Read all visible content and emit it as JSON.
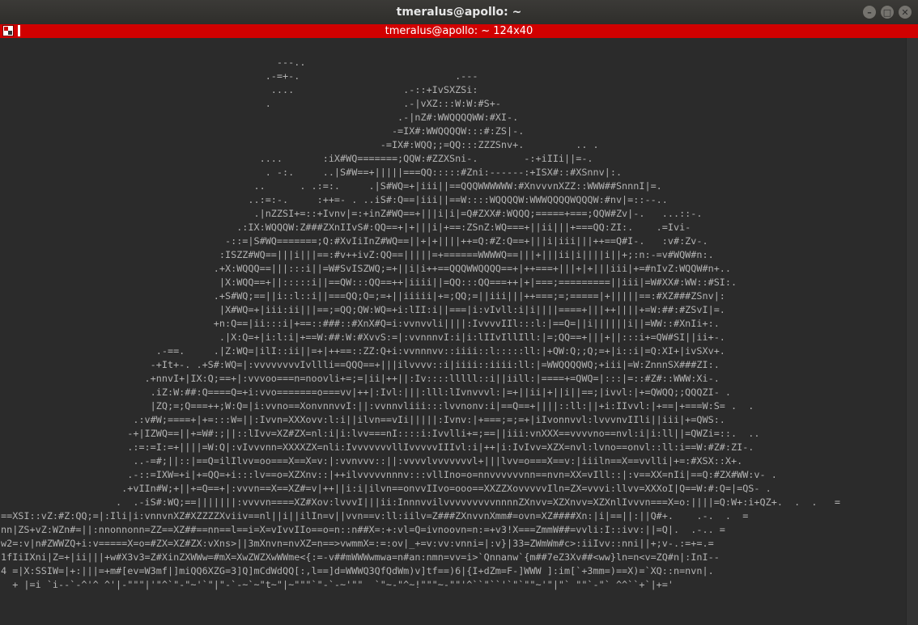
{
  "window": {
    "title": "tmeralus@apollo: ~",
    "controls": {
      "minimize": "–",
      "maximize": "□",
      "close": "✕"
    }
  },
  "tab": {
    "title": "tmeralus@apollo: ~ 124x40"
  },
  "terminal": {
    "lines": [
      "                                                ---..",
      "                                              .-=+-.                           .---",
      "                                               ....                   .-::+IvSXZSi:",
      "                                              .                       .-|vXZ:::W:W:#S+-",
      "                                                                     .-|nZ#:WWQQQQWW:#XI-.",
      "                                                                    -=IX#:WWQQQQW:::#:ZS|-.",
      "                                                                  -=IX#:WQQ;;=QQ:::ZZZSnv+.         .. .",
      "                                             ....       :iX#WQ=======;QQW:#ZZXSni-.        -:+iIIi||=-.",
      "                                              . -:.     ..|S#W==+|||||===QQ:::::#Zni:------:+ISX#::#XSnnv|:.",
      "                                            ..      . .:=:.     .|S#WQ=+|iii||==QQQWWWWWW:#XnvvvnXZZ::WWW##SnnnI|=.",
      "                                           ..:=:-.     :++=- . ..iS#:Q==|iii||==W::::WQQQQW:WWWQQQQWQQQW:#nv|=::--..",
      "                                            .|nZZSI+=::+Ivnv|=:+inZ#WQ==+|||i|i|=Q#ZXX#:WQQQ;=====+===;QQW#Zv|-.   ...::-.",
      "                                         .:IX:WQQQW:Z###ZXnIIvS#:QQ==+|+|||i|+==:ZSnZ:WQ===+||ii|||+===QQ:ZI:.    .=Ivi-",
      "                                       -::=|S#WQ=======;Q:#XvIiInZ#WQ==||+|+||||++=Q:#Z:Q==+|||i|iii|||++==Q#I-.   :v#:Zv-.",
      "                                      :ISZZ#WQ==|||i|||==:#v++ivZ:QQ==|||||=+======WWWWQ==|||+|||ii|i||||i||+;:n:-=v#WQW#n:.",
      "                                     .+X:WQQQ==|||:::i||=W#SvISZWQ;=+||i|i++==QQQWWQQQQ==+|++===+|||+|+|||iii|+=#nIvZ:WQQW#n+..",
      "                                      |X:WQQ==+||:::::i||==QW:::QQ==++|iiii||=QQ:::QQ===++|+|===;=========||iii|=W#XX#:WW::#SI:.",
      "                                     .+S#WQ;==||i::l::i||===QQ;Q=;=+||iiiii|+=;QQ;=||iii|||++===;=;=====|+|||||==:#XZ###ZSnv|:",
      "                                      |X#WQ=+|iii:ii|||==;=QQ;QW:WQ=+i:lII:i||===|i:vIvll:i|i||||====+|||++||||+=W:##:#ZSvI|=.",
      "                                     +n:Q==|ii:::i|+==::###::#XnX#Q=i:vvnvvli||||:IvvvvIIl:::l:|==Q=||i||||||i||=WW::#XnIi+:.",
      "                                      .|X:Q=+|i:l:i|+==W:##:W:#XvvS:=|:vvnnnvI:i|i:lIIvIllIll:|=;QQ==+|||+||:::i+=QW#SI||ii+-.",
      "                           .-==.     .|Z:WQ=|ilI::ii||=+|++==::ZZ:Q+i:vvnnnvv::iiii::l:::::ll:|+QW:Q;;Q;=+|i::i|=Q:XI+|ivSXv+.",
      "                          -+It+-. .+S#:WQ=|:vvvvvvvvIvllli==QQQ==+|||ilvvvv::i|iiii::iiii:ll:|=WWQQQQWQ;+iii|=W:ZnnnSX###ZI:.",
      "                         .+nnvI+|IX:Q;==+|:vvvoo===n=noovli+=;=|ii|++||:Iv::::lllll::i||iill:|====+=QWQ=|:::|=::#Z#::WWW:Xi-.",
      "                          .iZ:W:##:Q====Q=+i:vvo=======o===vv|++|:Ivl:|||:lll:lIvnvvvl:|=+||ii|+||i||==;|ivvl:|+=QWQQ;;QQQZI- .",
      "                          |ZQ;=;Q===++;W:Q=|i:vvno==XonvnnvvI:||:vvnnvliii:::lvvnonv:i|==Q==+||||::ll:||+i:IIvvl:|+==|+===W:S= .  .",
      "                       .:v#W;====+|+=:::W=||:Ivvn=XXXovv:l:i||ilvn==vIi|||||:Ivnv:|+===;=;=+|iIvonnvvl:lvvvnvIIli||iii|+=QWS:.",
      "                      -+|IZWQ==||+=W#:;||::lIvv=XZ#ZX=nl:i|i:lvv===nI::::i:Ivvlli+=;==||iii:vnXXX==vvvvno==nvl:i|i:ll||=QWZi=::.  ..",
      "                      .:=:=I:=+||||=W:Q|:vIvvvnn=XXXXZX=nli:IvvvvvvvllIvvvvvIIIvl:i|++|i:IvIvv=XZX=nvl:lvno==onvl::ll:i==W:#Z#:ZI-.",
      "                       ..-=#;||::|==Q=ilIlvv=oo===X==X=v:|:vvnvvv::||:vvvvlvvvvvvvl+|||lvv=o===X==v:|iiiln==X==vvlli|+=:#XSX::X+.",
      "                      .-::=IXW=+i|+=QQ=+i:::lv==o=XZXnv::|++ilvvvvvnnnv:::vllIno=o=nnvvvvvvnn==nvn=XX=vIll::|:v==XX=nIi|==Q:#ZX#WW:v- .",
      "                     .+vIIn#W;+||+=Q==+|:vvvn==X==XZ#=v|++||i:i|ilvn==onvvIIvo=ooo==XXZZXovvvvvIln=ZX=vvvi:llvv=XXXoI|Q==W:#:Q=|=QS- .",
      "                    .  .-iS#:WQ;==|||||||:vvvvn====XZ#Xov:lvvvI|||ii:InnnvvilvvvvvvvvvnnnnZXnvv=XZXnvv=XZXnlIvvvn===X=o:||||=Q:W+:i+QZ+.  .  .   =",
      "==XSI::vZ:#Z:QQ;=|:Ili|i:vnnvnXZ#XZZZZXviiv==nl||i||ilIn=v||vvn==v:ll:iilv=Z###ZXnvvnXmm#=ovn=XZ####Xn:|i|==||:||Q#+.    .-.  .  =",
      "nn|ZS+vZ:WZn#=||:nnonnonn=ZZ==XZ##==nn==l==i=X=vIvvIIo==o=n::n##X=:+:vl=Q=ivnoovn=n:=+v3!X===ZmmW##=vvli:I::ivv:||=Q|.  .-.. =",
      "w2=:v|n#ZWWZQ+i:v=====X=o=#ZX=XZ#ZX:vXns>||3mXnvn=nvXZ=n==>vwmmX=:=:ov|_+=v:vv:vnni=|:v}|33=ZWmWm#c>:iiIvv::nni||+;v-.:=+=.=",
      "1fIiIXni|Z=+|ii|||+w#X3v3=Z#XinZXWWw=#mX=XwZWZXwWWme<{:=-v##mWWWwmwa=n#an:nmn=vv=i>`Qnnanw`{m##7eZ3Xv##<ww}ln=n<v=ZQ#n|:InI--",
      "4 =|X:SSIW=|+:|||=+m#[ev=W3mf|]miQQ6XZG=3]Q]mCdWdQQ[:,l==]d=WWWQ3QfQdWm)v]tf==)6|{I+dZm=F-]WWW ]:im[`+3mm=)==X)=`XQ::n=nvn|.",
      "  + |=i `i--`-^'^ ^'|-\"\"\"|'\"^`\"-\"~'`\"|\"-`-~`~\"t~\"|~\"\"\"`\"-`-~'\"\"  `\"~-\"^~!\"\"\"~-\"\"'^``\"``'`\"`\"\"~'\"|\"` \"\"`-\"` ^^``+`|+='"
    ]
  }
}
